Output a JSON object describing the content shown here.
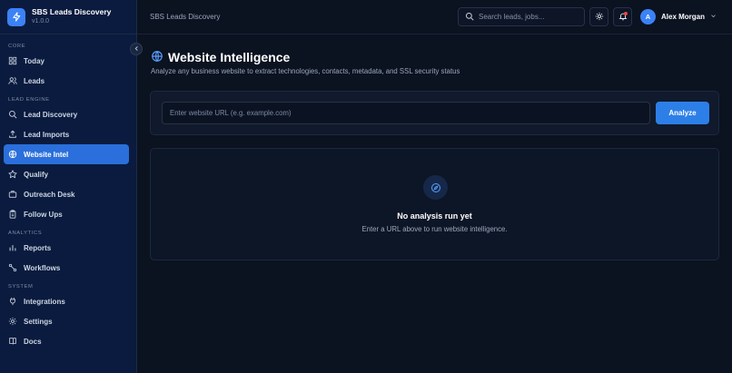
{
  "app": {
    "name": "SBS Leads Discovery",
    "version": "v1.0.0"
  },
  "sidebar": {
    "sections": [
      {
        "label": "CORE",
        "items": [
          {
            "label": "Today",
            "icon": "grid-icon"
          },
          {
            "label": "Leads",
            "icon": "users-icon"
          }
        ]
      },
      {
        "label": "LEAD ENGINE",
        "items": [
          {
            "label": "Lead Discovery",
            "icon": "search-icon"
          },
          {
            "label": "Lead Imports",
            "icon": "upload-icon"
          },
          {
            "label": "Website Intel",
            "icon": "globe-icon",
            "active": true
          },
          {
            "label": "Qualify",
            "icon": "star-icon"
          },
          {
            "label": "Outreach Desk",
            "icon": "briefcase-icon"
          },
          {
            "label": "Follow Ups",
            "icon": "clipboard-icon"
          }
        ]
      },
      {
        "label": "ANALYTICS",
        "items": [
          {
            "label": "Reports",
            "icon": "bar-chart-icon"
          },
          {
            "label": "Workflows",
            "icon": "workflow-icon"
          }
        ]
      },
      {
        "label": "SYSTEM",
        "items": [
          {
            "label": "Integrations",
            "icon": "plug-icon"
          },
          {
            "label": "Settings",
            "icon": "gear-icon"
          },
          {
            "label": "Docs",
            "icon": "book-icon"
          }
        ]
      }
    ]
  },
  "topbar": {
    "title": "SBS Leads Discovery",
    "search_placeholder": "Search leads, jobs...",
    "user": {
      "initial": "A",
      "name": "Alex Morgan"
    }
  },
  "page": {
    "title": "Website Intelligence",
    "subtitle": "Analyze any business website to extract technologies, contacts, metadata, and SSL security status",
    "url_placeholder": "Enter website URL (e.g. example.com)",
    "analyze_label": "Analyze",
    "empty": {
      "title": "No analysis run yet",
      "text": "Enter a URL above to run website intelligence."
    }
  },
  "colors": {
    "accent": "#2d7fe8",
    "sidebar_bg": "#0b1b3f",
    "page_bg": "#0b1220",
    "notification": "#ef4444"
  }
}
